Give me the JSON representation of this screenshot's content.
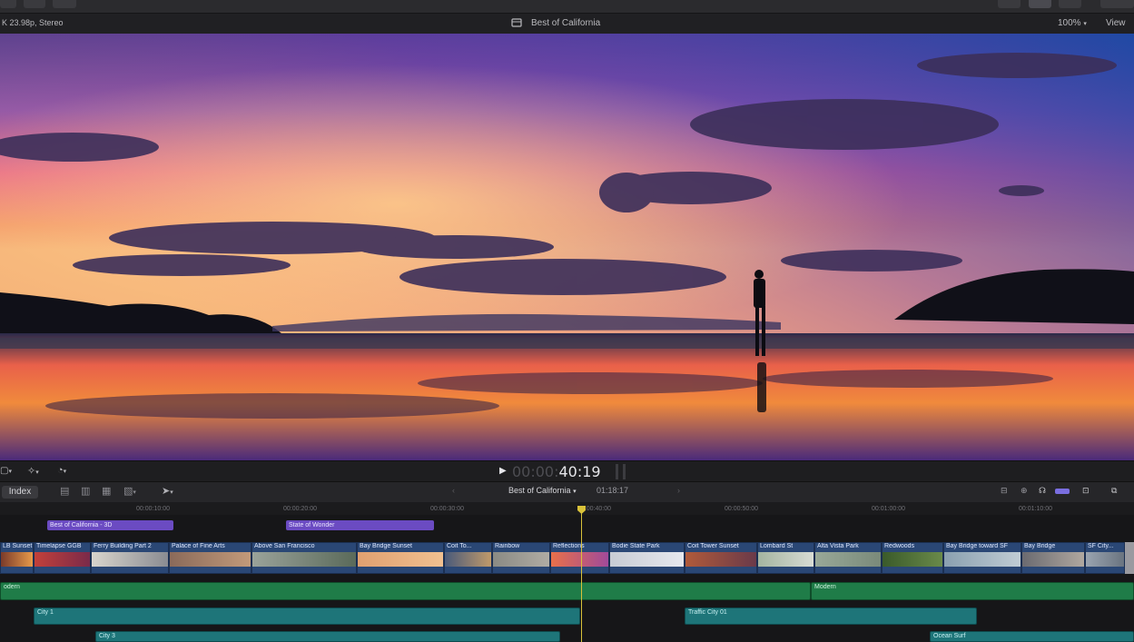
{
  "viewer": {
    "format_info": "K 23.98p, Stereo",
    "title": "Best of California",
    "zoom": "100%",
    "view_menu": "View"
  },
  "transport": {
    "timecode_dim": "00:00:",
    "timecode_lit": "40:19"
  },
  "timeline": {
    "index_label": "Index",
    "project_name": "Best of California",
    "duration": "01:18:17",
    "ruler": [
      "00:00:10:00",
      "00:00:20:00",
      "00:00:30:00",
      "00:00:40:00",
      "00:00:50:00",
      "00:01:00:00",
      "00:01:10:00"
    ],
    "lanes": [
      {
        "label": "Best of California - 3D"
      },
      {
        "label": "State of Wonder"
      }
    ],
    "clips": [
      {
        "label": "LB Sunset"
      },
      {
        "label": "Timelapse GGB"
      },
      {
        "label": "Ferry Building Part 2"
      },
      {
        "label": "Palace of Fine Arts"
      },
      {
        "label": "Above San Francisco"
      },
      {
        "label": "Bay Bridge Sunset"
      },
      {
        "label": "Coit To..."
      },
      {
        "label": "Rainbow"
      },
      {
        "label": "Reflections"
      },
      {
        "label": "Bodie State Park"
      },
      {
        "label": "Coit Tower Sunset"
      },
      {
        "label": "Lombard St"
      },
      {
        "label": "Alta Vista Park"
      },
      {
        "label": "Redwoods"
      },
      {
        "label": "Bay Bridge toward SF"
      },
      {
        "label": "Bay Bridge"
      },
      {
        "label": "SF City..."
      }
    ],
    "audio": [
      {
        "label": "odern"
      },
      {
        "label": "Modern"
      },
      {
        "label": "City 1"
      },
      {
        "label": "Traffic City 01"
      },
      {
        "label": "City 3"
      },
      {
        "label": "Ocean Surf"
      }
    ]
  },
  "colors": {
    "accent_purple": "#6b4bc2",
    "clip_blue": "#2a4775",
    "audio_green": "#1f7c48",
    "audio_teal": "#1e7579",
    "playhead": "#d9c23a"
  }
}
